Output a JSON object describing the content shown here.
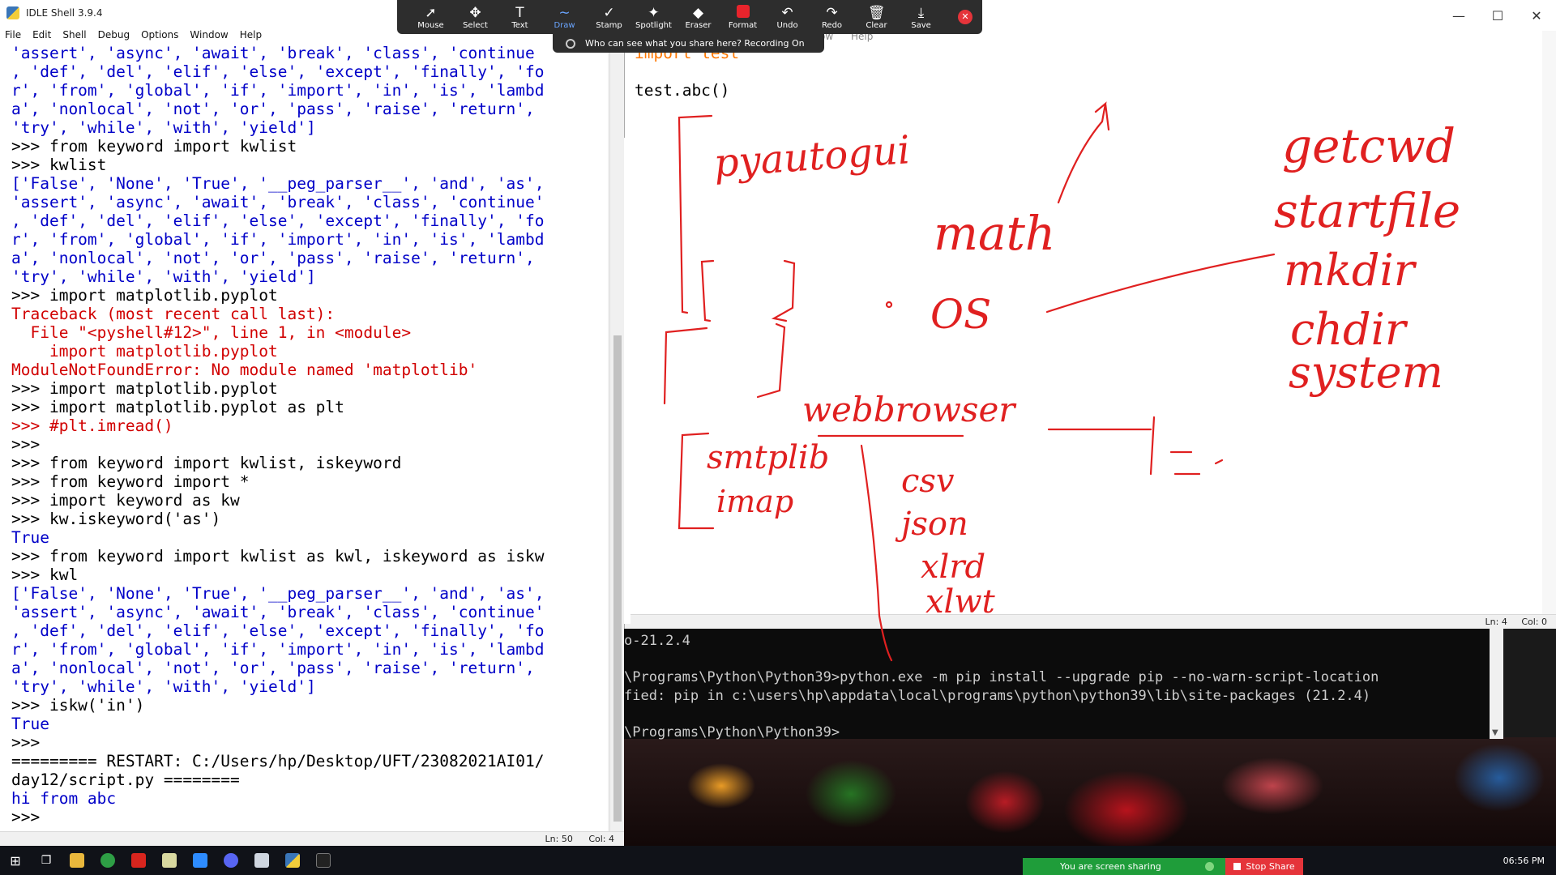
{
  "shell": {
    "title": "IDLE Shell 3.9.4",
    "menu": [
      "File",
      "Edit",
      "Shell",
      "Debug",
      "Options",
      "Window",
      "Help"
    ],
    "lines": [
      {
        "t": "'assert', 'async', 'await', 'break', 'class', 'continue",
        "c": "out"
      },
      {
        "t": ", 'def', 'del', 'elif', 'else', 'except', 'finally', 'fo",
        "c": "out"
      },
      {
        "t": "r', 'from', 'global', 'if', 'import', 'in', 'is', 'lambd",
        "c": "out"
      },
      {
        "t": "a', 'nonlocal', 'not', 'or', 'pass', 'raise', 'return',",
        "c": "out"
      },
      {
        "t": "'try', 'while', 'with', 'yield']",
        "c": "out"
      },
      {
        "t": ">>> from keyword import kwlist",
        "c": "code"
      },
      {
        "t": ">>> kwlist",
        "c": "code"
      },
      {
        "t": "['False', 'None', 'True', '__peg_parser__', 'and', 'as',",
        "c": "out"
      },
      {
        "t": "'assert', 'async', 'await', 'break', 'class', 'continue'",
        "c": "out"
      },
      {
        "t": ", 'def', 'del', 'elif', 'else', 'except', 'finally', 'fo",
        "c": "out"
      },
      {
        "t": "r', 'from', 'global', 'if', 'import', 'in', 'is', 'lambd",
        "c": "out"
      },
      {
        "t": "a', 'nonlocal', 'not', 'or', 'pass', 'raise', 'return',",
        "c": "out"
      },
      {
        "t": "'try', 'while', 'with', 'yield']",
        "c": "out"
      },
      {
        "t": ">>> import matplotlib.pyplot",
        "c": "code"
      },
      {
        "t": "Traceback (most recent call last):",
        "c": "err"
      },
      {
        "t": "  File \"<pyshell#12>\", line 1, in <module>",
        "c": "err"
      },
      {
        "t": "    import matplotlib.pyplot",
        "c": "err"
      },
      {
        "t": "ModuleNotFoundError: No module named 'matplotlib'",
        "c": "err"
      },
      {
        "t": ">>> import matplotlib.pyplot",
        "c": "code"
      },
      {
        "t": ">>> import matplotlib.pyplot as plt",
        "c": "code"
      },
      {
        "t": ">>> #plt.imread()",
        "c": "err"
      },
      {
        "t": ">>>",
        "c": "code"
      },
      {
        "t": ">>> from keyword import kwlist, iskeyword",
        "c": "code"
      },
      {
        "t": ">>> from keyword import *",
        "c": "code"
      },
      {
        "t": ">>> import keyword as kw",
        "c": "code"
      },
      {
        "t": ">>> kw.iskeyword('as')",
        "c": "code"
      },
      {
        "t": "True",
        "c": "out"
      },
      {
        "t": ">>> from keyword import kwlist as kwl, iskeyword as iskw",
        "c": "code"
      },
      {
        "t": ">>> kwl",
        "c": "code"
      },
      {
        "t": "['False', 'None', 'True', '__peg_parser__', 'and', 'as',",
        "c": "out"
      },
      {
        "t": "'assert', 'async', 'await', 'break', 'class', 'continue'",
        "c": "out"
      },
      {
        "t": ", 'def', 'del', 'elif', 'else', 'except', 'finally', 'fo",
        "c": "out"
      },
      {
        "t": "r', 'from', 'global', 'if', 'import', 'in', 'is', 'lambd",
        "c": "out"
      },
      {
        "t": "a', 'nonlocal', 'not', 'or', 'pass', 'raise', 'return',",
        "c": "out"
      },
      {
        "t": "'try', 'while', 'with', 'yield']",
        "c": "out"
      },
      {
        "t": ">>> iskw('in')",
        "c": "code"
      },
      {
        "t": "True",
        "c": "out"
      },
      {
        "t": ">>>",
        "c": "code"
      },
      {
        "t": "========= RESTART: C:/Users/hp/Desktop/UFT/23082021AI01/",
        "c": "code"
      },
      {
        "t": "day12/script.py ========",
        "c": "code"
      },
      {
        "t": "hi from abc",
        "c": "out"
      },
      {
        "t": ">>>",
        "c": "code"
      }
    ],
    "status": {
      "ln": "Ln: 50",
      "col": "Col: 4"
    }
  },
  "editor": {
    "menu": [
      "ow",
      "Help"
    ],
    "lines": [
      {
        "t": "import test",
        "k": true
      },
      {
        "t": "",
        "k": false
      },
      {
        "t": "test.abc()",
        "k": false
      }
    ],
    "status": {
      "ln": "Ln: 4",
      "col": "Col: 0"
    }
  },
  "cmd": {
    "lines": [
      "o-21.2.4",
      "",
      "\\Programs\\Python\\Python39>python.exe -m pip install --upgrade pip --no-warn-script-location",
      "fied: pip in c:\\users\\hp\\appdata\\local\\programs\\python\\python39\\lib\\site-packages (21.2.4)",
      "",
      "\\Programs\\Python\\Python39>"
    ]
  },
  "annotation_toolbar": {
    "tools": [
      {
        "label": "Mouse",
        "icon": "arrow-icon",
        "glyph": "➚"
      },
      {
        "label": "Select",
        "icon": "move-icon",
        "glyph": "✥"
      },
      {
        "label": "Text",
        "icon": "text-icon",
        "glyph": "T"
      },
      {
        "label": "Draw",
        "icon": "draw-icon",
        "glyph": "∼"
      },
      {
        "label": "Stamp",
        "icon": "check-icon",
        "glyph": "✓"
      },
      {
        "label": "Spotlight",
        "icon": "spotlight-icon",
        "glyph": "✦"
      },
      {
        "label": "Eraser",
        "icon": "eraser-icon",
        "glyph": "◆"
      },
      {
        "label": "Format",
        "icon": "format-icon",
        "glyph": ""
      },
      {
        "label": "Undo",
        "icon": "undo-icon",
        "glyph": "↶"
      },
      {
        "label": "Redo",
        "icon": "redo-icon",
        "glyph": "↷"
      },
      {
        "label": "Clear",
        "icon": "trash-icon",
        "glyph": "🗑"
      },
      {
        "label": "Save",
        "icon": "save-icon",
        "glyph": "⤓"
      }
    ],
    "active_tool": "Draw",
    "share_note": "Who can see what you share here? Recording On"
  },
  "drawing": {
    "labels": [
      "pyautogui",
      "math",
      "OS",
      "webbrowser",
      "smtplib",
      "imap",
      "csv",
      "json",
      "xlrd",
      "xlwt",
      "getcwd",
      "startfile",
      "mkdir",
      "chdir",
      "system",
      "=-"
    ],
    "ink_color": "#e02020"
  },
  "taskbar": {
    "share_label": "You are screen sharing",
    "stop_label": "Stop Share",
    "clock": "06:56 PM"
  }
}
